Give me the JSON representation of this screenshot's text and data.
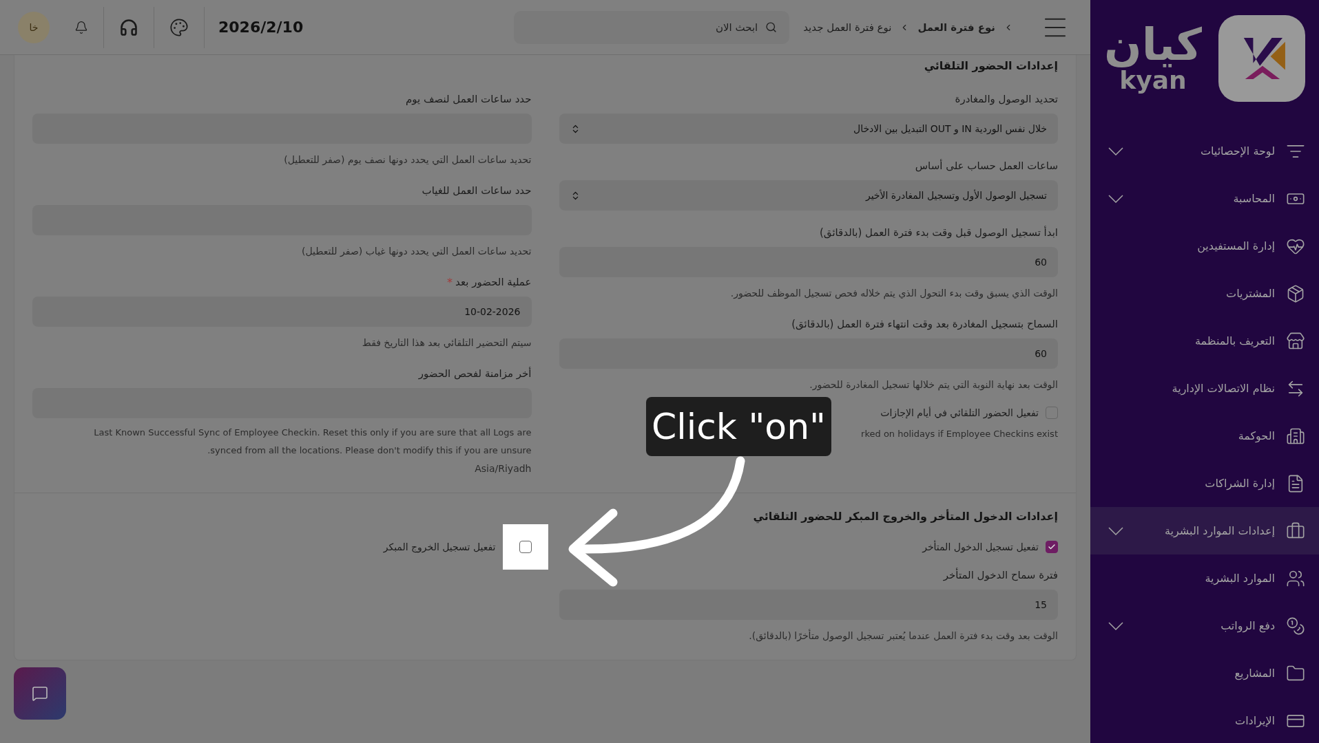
{
  "topbar": {
    "breadcrumbs": [
      {
        "label": "نوع فترة العمل",
        "current": false
      },
      {
        "label": "نوع فترة العمل جديد",
        "current": true
      }
    ],
    "search": {
      "placeholder": "ابحث الان"
    },
    "date": "2026/2/10",
    "avatar": "خا"
  },
  "sidebar": {
    "logo_ar": "كيان",
    "logo_en": "kyan",
    "items": [
      {
        "label": "لوحة الإحصائيات",
        "expandable": true,
        "selected": false
      },
      {
        "label": "المحاسبة",
        "expandable": true,
        "selected": false
      },
      {
        "label": "إدارة المستفيدين",
        "expandable": false,
        "selected": false
      },
      {
        "label": "المشتريات",
        "expandable": false,
        "selected": false
      },
      {
        "label": "التعريف بالمنظمة",
        "expandable": false,
        "selected": false
      },
      {
        "label": "نظام الاتصالات الإدارية",
        "expandable": false,
        "selected": false
      },
      {
        "label": "الحوكمة",
        "expandable": false,
        "selected": false
      },
      {
        "label": "إدارة الشراكات",
        "expandable": false,
        "selected": false
      },
      {
        "label": "إعدادات الموارد البشرية",
        "expandable": true,
        "selected": true
      },
      {
        "label": "الموارد البشرية",
        "expandable": false,
        "selected": false
      },
      {
        "label": "دفع الرواتب",
        "expandable": true,
        "selected": false
      },
      {
        "label": "المشاريع",
        "expandable": false,
        "selected": false
      },
      {
        "label": "الإيرادات",
        "expandable": false,
        "selected": false
      }
    ]
  },
  "sections": [
    {
      "title": "إعدادات الحضور التلقائي",
      "columns": [
        [
          {
            "kind": "select",
            "label": "تحديد الوصول والمغادرة",
            "value": "خلال نفس الوردية IN و OUT التبديل بين الادخال"
          },
          {
            "kind": "select",
            "label": "ساعات العمل حساب على أساس",
            "value": "تسجيل الوصول الأول وتسجيل المغادرة الأخير"
          },
          {
            "kind": "input",
            "label": "ابدأ تسجيل الوصول قبل وقت بدء فترة العمل (بالدقائق)",
            "value": "60",
            "help": "الوقت الذي يسبق وقت بدء التحول الذي يتم خلاله فحص تسجيل الموظف للحضور."
          },
          {
            "kind": "input",
            "label": "السماح بتسجيل المغادرة بعد وقت انتهاء فترة العمل (بالدقائق)",
            "value": "60",
            "help": "الوقت بعد نهاية النوبة التي يتم خلالها تسجيل المغادرة للحضور."
          },
          {
            "kind": "checkbox",
            "label": "تفعيل الحضور التلقائي في أيام الإجازات",
            "checked": false,
            "help": "rked on holidays if Employee Checkins exist"
          }
        ],
        [
          {
            "kind": "input",
            "label": "حدد ساعات العمل لنصف يوم",
            "help": "تحديد ساعات العمل التي يحدد دونها نصف يوم (صفر للتعطيل)"
          },
          {
            "kind": "input",
            "label": "حدد ساعات العمل للغياب",
            "help": "تحديد ساعات العمل التي يحدد دونها غياب (صفر للتعطيل)"
          },
          {
            "kind": "input",
            "label": "عملية الحضور بعد",
            "required_mark": "*",
            "value": "10-02-2026",
            "help": "سيتم التحضير التلقائي بعد هذا التاريخ فقط"
          },
          {
            "kind": "input",
            "label": "أخر مزامنة لفحص الحضور",
            "help": "Last Known Successful Sync of Employee Checkin. Reset this only if you are sure that all Logs are synced from all the locations. Please don't modify this if you are unsure.",
            "note": "Asia/Riyadh"
          }
        ]
      ]
    },
    {
      "title": "إعدادات الدخول المتأخر والخروج المبكر للحضور التلقائي",
      "columns": [
        [
          {
            "kind": "checkbox",
            "label": "تفعيل تسجيل الدخول المتأخر",
            "checked": true
          },
          {
            "kind": "input",
            "label": "فترة سماح الدخول المتأخر",
            "value": "15",
            "help": "الوقت بعد وقت بدء فترة العمل عندما يُعتبر تسجيل الوصول متأخرًا (بالدقائق)."
          }
        ],
        [
          {
            "kind": "checkbox",
            "label": "تفعيل تسجيل الخروج المبكر",
            "checked": false,
            "spotlight": true
          }
        ]
      ]
    }
  ],
  "tour": {
    "tooltip": "Click \"on\""
  }
}
